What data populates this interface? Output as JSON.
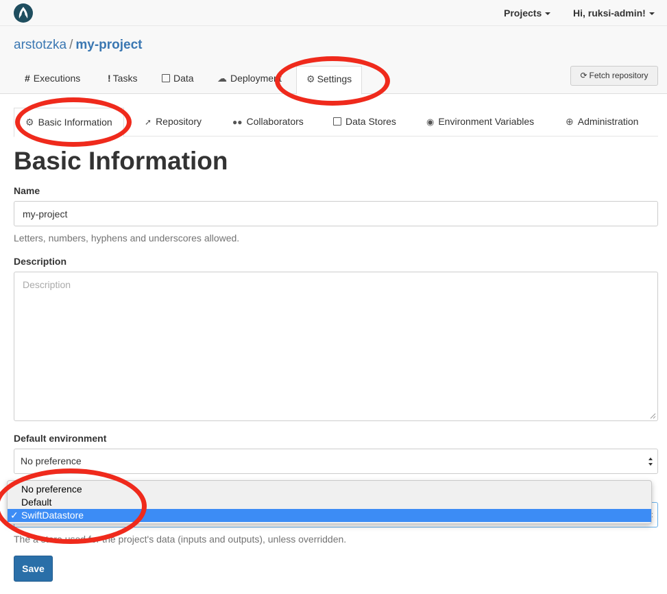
{
  "navbar": {
    "projects_label": "Projects",
    "user_label": "Hi, ruksi-admin!"
  },
  "breadcrumb": {
    "owner": "arstotzka",
    "separator": "/",
    "project": "my-project"
  },
  "main_tabs": [
    {
      "label": "Executions",
      "icon": "hash-icon",
      "glyph": "#"
    },
    {
      "label": "Tasks",
      "icon": "exclamation-icon",
      "glyph": "!"
    },
    {
      "label": "Data",
      "icon": "floppy-icon",
      "glyph": "🖫"
    },
    {
      "label": "Deployment",
      "icon": "cloud-icon",
      "glyph": "☁"
    },
    {
      "label": "Settings",
      "icon": "gear-icon",
      "glyph": "⚙",
      "active": true
    }
  ],
  "fetch_button": {
    "label": "Fetch repository",
    "icon": "refresh-icon",
    "glyph": "⟳"
  },
  "sub_tabs": [
    {
      "label": "Basic Information",
      "icon": "gears-icon",
      "glyph": "⚙",
      "active": true
    },
    {
      "label": "Repository",
      "icon": "rocket-icon",
      "glyph": "🚀"
    },
    {
      "label": "Collaborators",
      "icon": "users-icon",
      "glyph": "👥"
    },
    {
      "label": "Data Stores",
      "icon": "floppy-icon",
      "glyph": "🖫"
    },
    {
      "label": "Environment Variables",
      "icon": "eye-icon",
      "glyph": "👁"
    },
    {
      "label": "Administration",
      "icon": "lifebuoy-icon",
      "glyph": "⊕"
    }
  ],
  "page_title": "Basic Information",
  "form": {
    "name_label": "Name",
    "name_value": "my-project",
    "name_help": "Letters, numbers, hyphens and underscores allowed.",
    "description_label": "Description",
    "description_placeholder": "Description",
    "description_value": "",
    "environment_label": "Default environment",
    "environment_value": "No preference",
    "datastore_help": "The data store used for the project's data (inputs and outputs), unless overridden.",
    "datastore_help_visible": "The     a store used for the project's data (inputs and outputs), unless overridden.",
    "save_label": "Save"
  },
  "dropdown": {
    "options": [
      "No preference",
      "Default",
      "SwiftDatastore"
    ],
    "selected_index": 2,
    "check_glyph": "✓"
  },
  "colors": {
    "brand": "#1f4e5f",
    "link": "#3a77b2",
    "primary_button": "#2a6fa8",
    "selection": "#3c8cf5",
    "annotation": "#ef2a1c"
  }
}
